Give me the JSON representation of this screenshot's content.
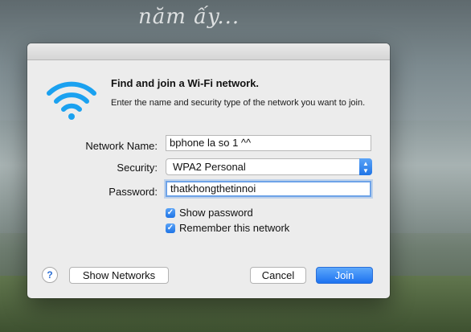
{
  "wallpaper": {
    "caption": "năm ấy..."
  },
  "dialog": {
    "heading": "Find and join a Wi-Fi network.",
    "description": "Enter the name and security type of the network you want to join.",
    "network_name": {
      "label": "Network Name:",
      "value": "bphone la so 1 ^^"
    },
    "security": {
      "label": "Security:",
      "value": "WPA2 Personal"
    },
    "password": {
      "label": "Password:",
      "value": "thatkhongthetinnoi"
    },
    "options": [
      {
        "label": "Show password",
        "checked": true
      },
      {
        "label": "Remember this network",
        "checked": true
      }
    ],
    "buttons": {
      "help": "?",
      "show_networks": "Show Networks",
      "cancel": "Cancel",
      "join": "Join"
    }
  },
  "colors": {
    "accent": "#1f74e6",
    "wifi": "#1aa1f0"
  },
  "icons": [
    "wifi-icon",
    "help-icon",
    "checkmark-icon",
    "select-arrows-icon"
  ]
}
